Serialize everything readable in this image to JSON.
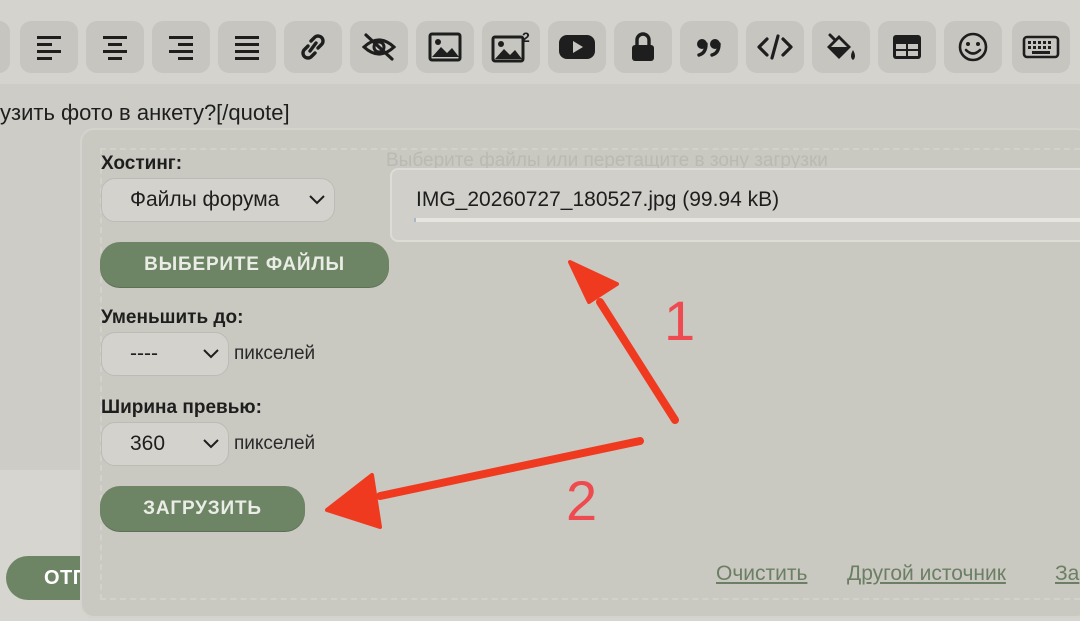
{
  "toolbar": {
    "buttons": [
      {
        "name": "align-left-icon"
      },
      {
        "name": "align-center-icon"
      },
      {
        "name": "align-right-icon"
      },
      {
        "name": "align-justify-icon"
      },
      {
        "name": "link-icon"
      },
      {
        "name": "hide-eye-icon"
      },
      {
        "name": "image-icon"
      },
      {
        "name": "image-2-icon",
        "sup": "2"
      },
      {
        "name": "video-icon"
      },
      {
        "name": "lock-icon"
      },
      {
        "name": "quote-icon"
      },
      {
        "name": "code-icon"
      },
      {
        "name": "paint-bucket-icon"
      },
      {
        "name": "table-icon"
      },
      {
        "name": "smiley-icon"
      },
      {
        "name": "keyboard-icon"
      }
    ]
  },
  "editor": {
    "text": "узить фото в анкету?[/quote]"
  },
  "send_button": {
    "label": "ОТП"
  },
  "upload": {
    "hosting_label": "Хостинг:",
    "hosting_value": "Файлы форума",
    "choose_files_label": "ВЫБЕРИТЕ ФАЙЛЫ",
    "drop_hint": "Выберите файлы или перетащите в зону загрузки",
    "file_name": "IMG_20260727_180527.jpg (99.94 kB)",
    "progress": 0.003,
    "reduce_label": "Уменьшить до:",
    "reduce_value": "----",
    "reduce_unit": "пикселей",
    "preview_label": "Ширина превью:",
    "preview_value": "360",
    "preview_unit": "пикселей",
    "upload_label": "ЗАГРУЗИТЬ",
    "footer_links": {
      "clear": "Очистить",
      "other_source": "Другой источник",
      "partial": "За"
    }
  },
  "annotations": {
    "num1": "1",
    "num2": "2",
    "color": "#f03a20"
  }
}
